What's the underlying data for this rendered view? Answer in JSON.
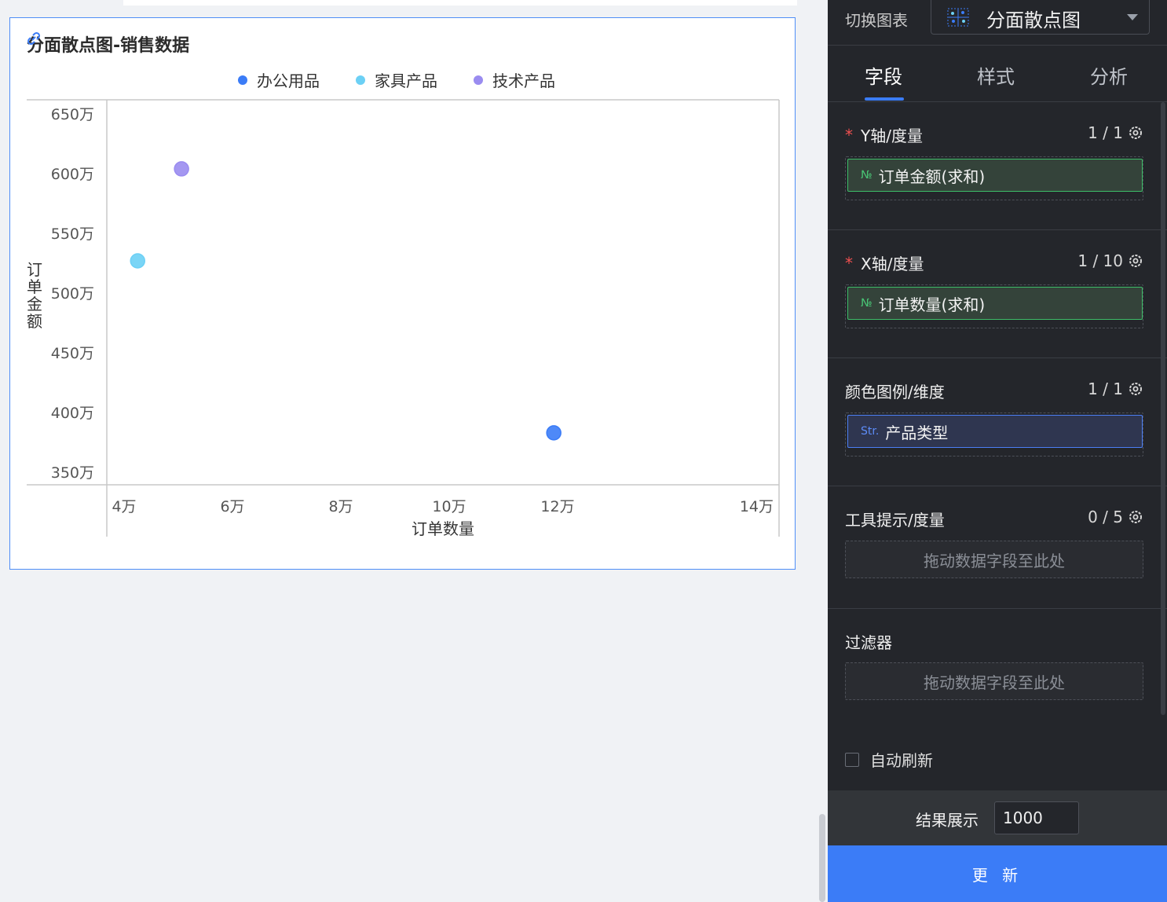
{
  "chart": {
    "title": "分面散点图-销售数据",
    "legend": [
      {
        "label": "办公用品",
        "color": "#3b7cf7"
      },
      {
        "label": "家具产品",
        "color": "#6cd0f5"
      },
      {
        "label": "技术产品",
        "color": "#9a8cf0"
      }
    ]
  },
  "chart_data": {
    "type": "scatter",
    "title": "分面散点图-销售数据",
    "xlabel": "订单数量",
    "ylabel": "订单金额",
    "x_ticks": [
      "4万",
      "6万",
      "8万",
      "10万",
      "12万",
      "14万"
    ],
    "y_ticks": [
      "650万",
      "600万",
      "550万",
      "500万",
      "450万",
      "400万",
      "350万"
    ],
    "series": [
      {
        "name": "办公用品",
        "color": "#3b7cf7",
        "points": [
          {
            "x": 119300,
            "y": 3830000
          }
        ]
      },
      {
        "name": "家具产品",
        "color": "#6cd0f5",
        "points": [
          {
            "x": 42500,
            "y": 5270000
          }
        ]
      },
      {
        "name": "技术产品",
        "color": "#9a8cf0",
        "points": [
          {
            "x": 50600,
            "y": 6040000
          }
        ]
      }
    ],
    "grid": false,
    "legend_position": "top-center"
  },
  "panel": {
    "switch_label": "切换图表",
    "chart_type": "分面散点图",
    "tabs": [
      "字段",
      "样式",
      "分析"
    ],
    "active_tab": "字段",
    "sections": {
      "y_axis": {
        "title": "Y轴/度量",
        "count": "1 / 1",
        "field_type": "№",
        "field": "订单金额(求和)"
      },
      "x_axis": {
        "title": "X轴/度量",
        "count": "1 / 10",
        "field_type": "№",
        "field": "订单数量(求和)"
      },
      "color": {
        "title": "颜色图例/维度",
        "count": "1 / 1",
        "field_type": "Str.",
        "field": "产品类型"
      },
      "tooltip": {
        "title": "工具提示/度量",
        "count": "0 / 5",
        "placeholder": "拖动数据字段至此处"
      },
      "filter": {
        "title": "过滤器",
        "placeholder": "拖动数据字段至此处"
      }
    },
    "auto_refresh": "自动刷新",
    "result_label": "结果展示",
    "result_value": "1000",
    "update_button": "更 新"
  }
}
